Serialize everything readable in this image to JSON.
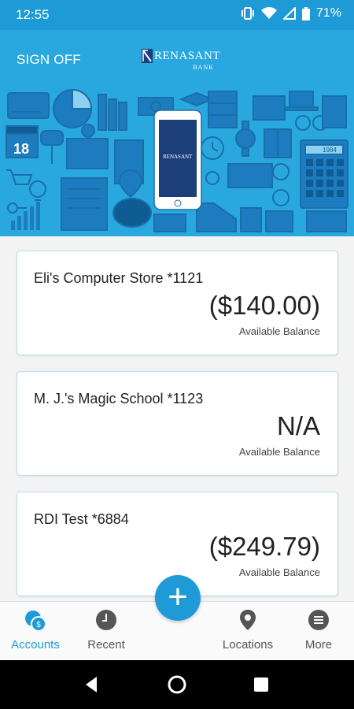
{
  "status_bar": {
    "time": "12:55",
    "battery": "71%",
    "icons": [
      "vibrate-icon",
      "wifi-icon",
      "signal-icon",
      "battery-icon"
    ]
  },
  "header": {
    "sign_off": "SIGN OFF",
    "brand_name": "RENASANT",
    "brand_sub": "BANK",
    "phone_brand": "RENASANT",
    "calc_display": "1984",
    "calendar_day": "18",
    "accent_color": "#29a8e0"
  },
  "accounts": [
    {
      "name": "Eli's Computer Store *1121",
      "balance": "($140.00)",
      "label": "Available Balance"
    },
    {
      "name": "M. J.'s Magic School *1123",
      "balance": "N/A",
      "label": "Available Balance"
    },
    {
      "name": "RDI Test *6884",
      "balance": "($249.79)",
      "label": "Available Balance"
    }
  ],
  "nav": {
    "accounts": "Accounts",
    "recent": "Recent",
    "locations": "Locations",
    "more": "More",
    "active": "accounts",
    "active_color": "#1e9bd7"
  },
  "fab": {
    "label": "+"
  }
}
